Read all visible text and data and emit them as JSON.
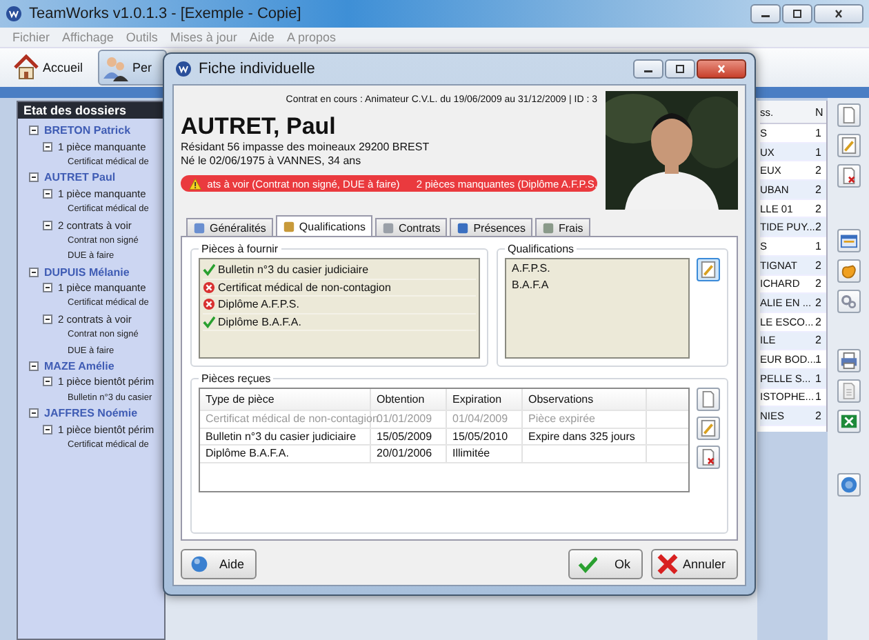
{
  "window": {
    "title": "TeamWorks v1.0.1.3 - [Exemple - Copie]"
  },
  "menu": [
    "Fichier",
    "Affichage",
    "Outils",
    "Mises à jour",
    "Aide",
    "A propos"
  ],
  "toolbar": [
    {
      "label": "Accueil",
      "selected": false
    },
    {
      "label": "Per",
      "selected": true
    }
  ],
  "dossiers": {
    "title": "Etat des dossiers",
    "items": [
      {
        "label": "BRETON Patrick",
        "expanded": true,
        "children": [
          {
            "label": "1 pièce manquante",
            "expanded": true,
            "children": [
              {
                "label": "Certificat médical de"
              }
            ]
          }
        ]
      },
      {
        "label": "AUTRET Paul",
        "expanded": true,
        "children": [
          {
            "label": "1 pièce manquante",
            "expanded": true,
            "children": [
              {
                "label": "Certificat médical de"
              }
            ]
          },
          {
            "label": "2 contrats à voir",
            "expanded": true,
            "children": [
              {
                "label": "Contrat non signé"
              },
              {
                "label": "DUE à faire"
              }
            ]
          }
        ]
      },
      {
        "label": "DUPUIS Mélanie",
        "expanded": true,
        "children": [
          {
            "label": "1 pièce manquante",
            "expanded": true,
            "children": [
              {
                "label": "Certificat médical de"
              }
            ]
          },
          {
            "label": "2 contrats à voir",
            "expanded": true,
            "children": [
              {
                "label": "Contrat non signé"
              },
              {
                "label": "DUE à faire"
              }
            ]
          }
        ]
      },
      {
        "label": "MAZE Amélie",
        "expanded": true,
        "children": [
          {
            "label": "1 pièce bientôt périm",
            "expanded": true,
            "children": [
              {
                "label": "Bulletin n°3 du casier"
              }
            ]
          }
        ]
      },
      {
        "label": "JAFFRES Noémie",
        "expanded": true,
        "children": [
          {
            "label": "1 pièce bientôt périm",
            "expanded": true,
            "children": [
              {
                "label": "Certificat médical de"
              }
            ]
          }
        ]
      }
    ]
  },
  "list": {
    "columns": [
      "ss.",
      "N"
    ],
    "rows": [
      [
        "S",
        "1"
      ],
      [
        "UX",
        "1"
      ],
      [
        "EUX",
        "2"
      ],
      [
        "UBAN",
        "2"
      ],
      [
        "LLE 01",
        "2"
      ],
      [
        "TIDE PUY...",
        "2"
      ],
      [
        "S",
        "1"
      ],
      [
        "TIGNAT",
        "2"
      ],
      [
        "ICHARD",
        "2"
      ],
      [
        "ALIE EN ...",
        "2"
      ],
      [
        "LE ESCO...",
        "2"
      ],
      [
        "ILE",
        "2"
      ],
      [
        "EUR BOD...",
        "1"
      ],
      [
        "PELLE S...",
        "1"
      ],
      [
        "ISTOPHE...",
        "1"
      ],
      [
        "NIES",
        "2"
      ]
    ]
  },
  "dialog": {
    "title": "Fiche individuelle",
    "contract": "Contrat en cours : Animateur C.V.L. du 19/06/2009 au 31/12/2009 | ID : 3",
    "name": "AUTRET, Paul",
    "address": "Résidant 56 impasse des moineaux 29200 BREST",
    "birth": "Né le 02/06/1975 à VANNES, 34 ans",
    "alerts": [
      "ats à voir (Contrat non signé, DUE à faire)",
      "2 pièces manquantes (Diplôme A.F.P.S."
    ],
    "tabs": [
      {
        "label": "Généralités",
        "selected": false
      },
      {
        "label": "Qualifications",
        "selected": true
      },
      {
        "label": "Contrats",
        "selected": false
      },
      {
        "label": "Présences",
        "selected": false
      },
      {
        "label": "Frais",
        "selected": false
      }
    ],
    "pieces_a_fournir": {
      "title": "Pièces à fournir",
      "items": [
        {
          "label": "Bulletin n°3 du casier judiciaire",
          "provided": true
        },
        {
          "label": "Certificat médical de non-contagion",
          "provided": false
        },
        {
          "label": "Diplôme A.F.P.S.",
          "provided": false
        },
        {
          "label": "Diplôme B.A.F.A.",
          "provided": true
        }
      ]
    },
    "qualifications": {
      "title": "Qualifications",
      "items": [
        "A.F.P.S.",
        "B.A.F.A"
      ]
    },
    "pieces_recues": {
      "title": "Pièces reçues",
      "columns": [
        "Type de pièce",
        "Obtention",
        "Expiration",
        "Observations"
      ],
      "rows": [
        {
          "cells": [
            "Certificat médical de non-contagion",
            "01/01/2009",
            "01/04/2009",
            "Pièce expirée"
          ],
          "expired": true
        },
        {
          "cells": [
            "Bulletin n°3 du casier judiciaire",
            "15/05/2009",
            "15/05/2010",
            "Expire dans 325 jours"
          ],
          "expired": false
        },
        {
          "cells": [
            "Diplôme B.A.F.A.",
            "20/01/2006",
            "Illimitée",
            ""
          ],
          "expired": false
        }
      ]
    },
    "buttons": [
      {
        "label": "Aide",
        "kind": "help"
      },
      {
        "label": "Ok",
        "kind": "ok"
      },
      {
        "label": "Annuler",
        "kind": "cancel"
      }
    ]
  }
}
